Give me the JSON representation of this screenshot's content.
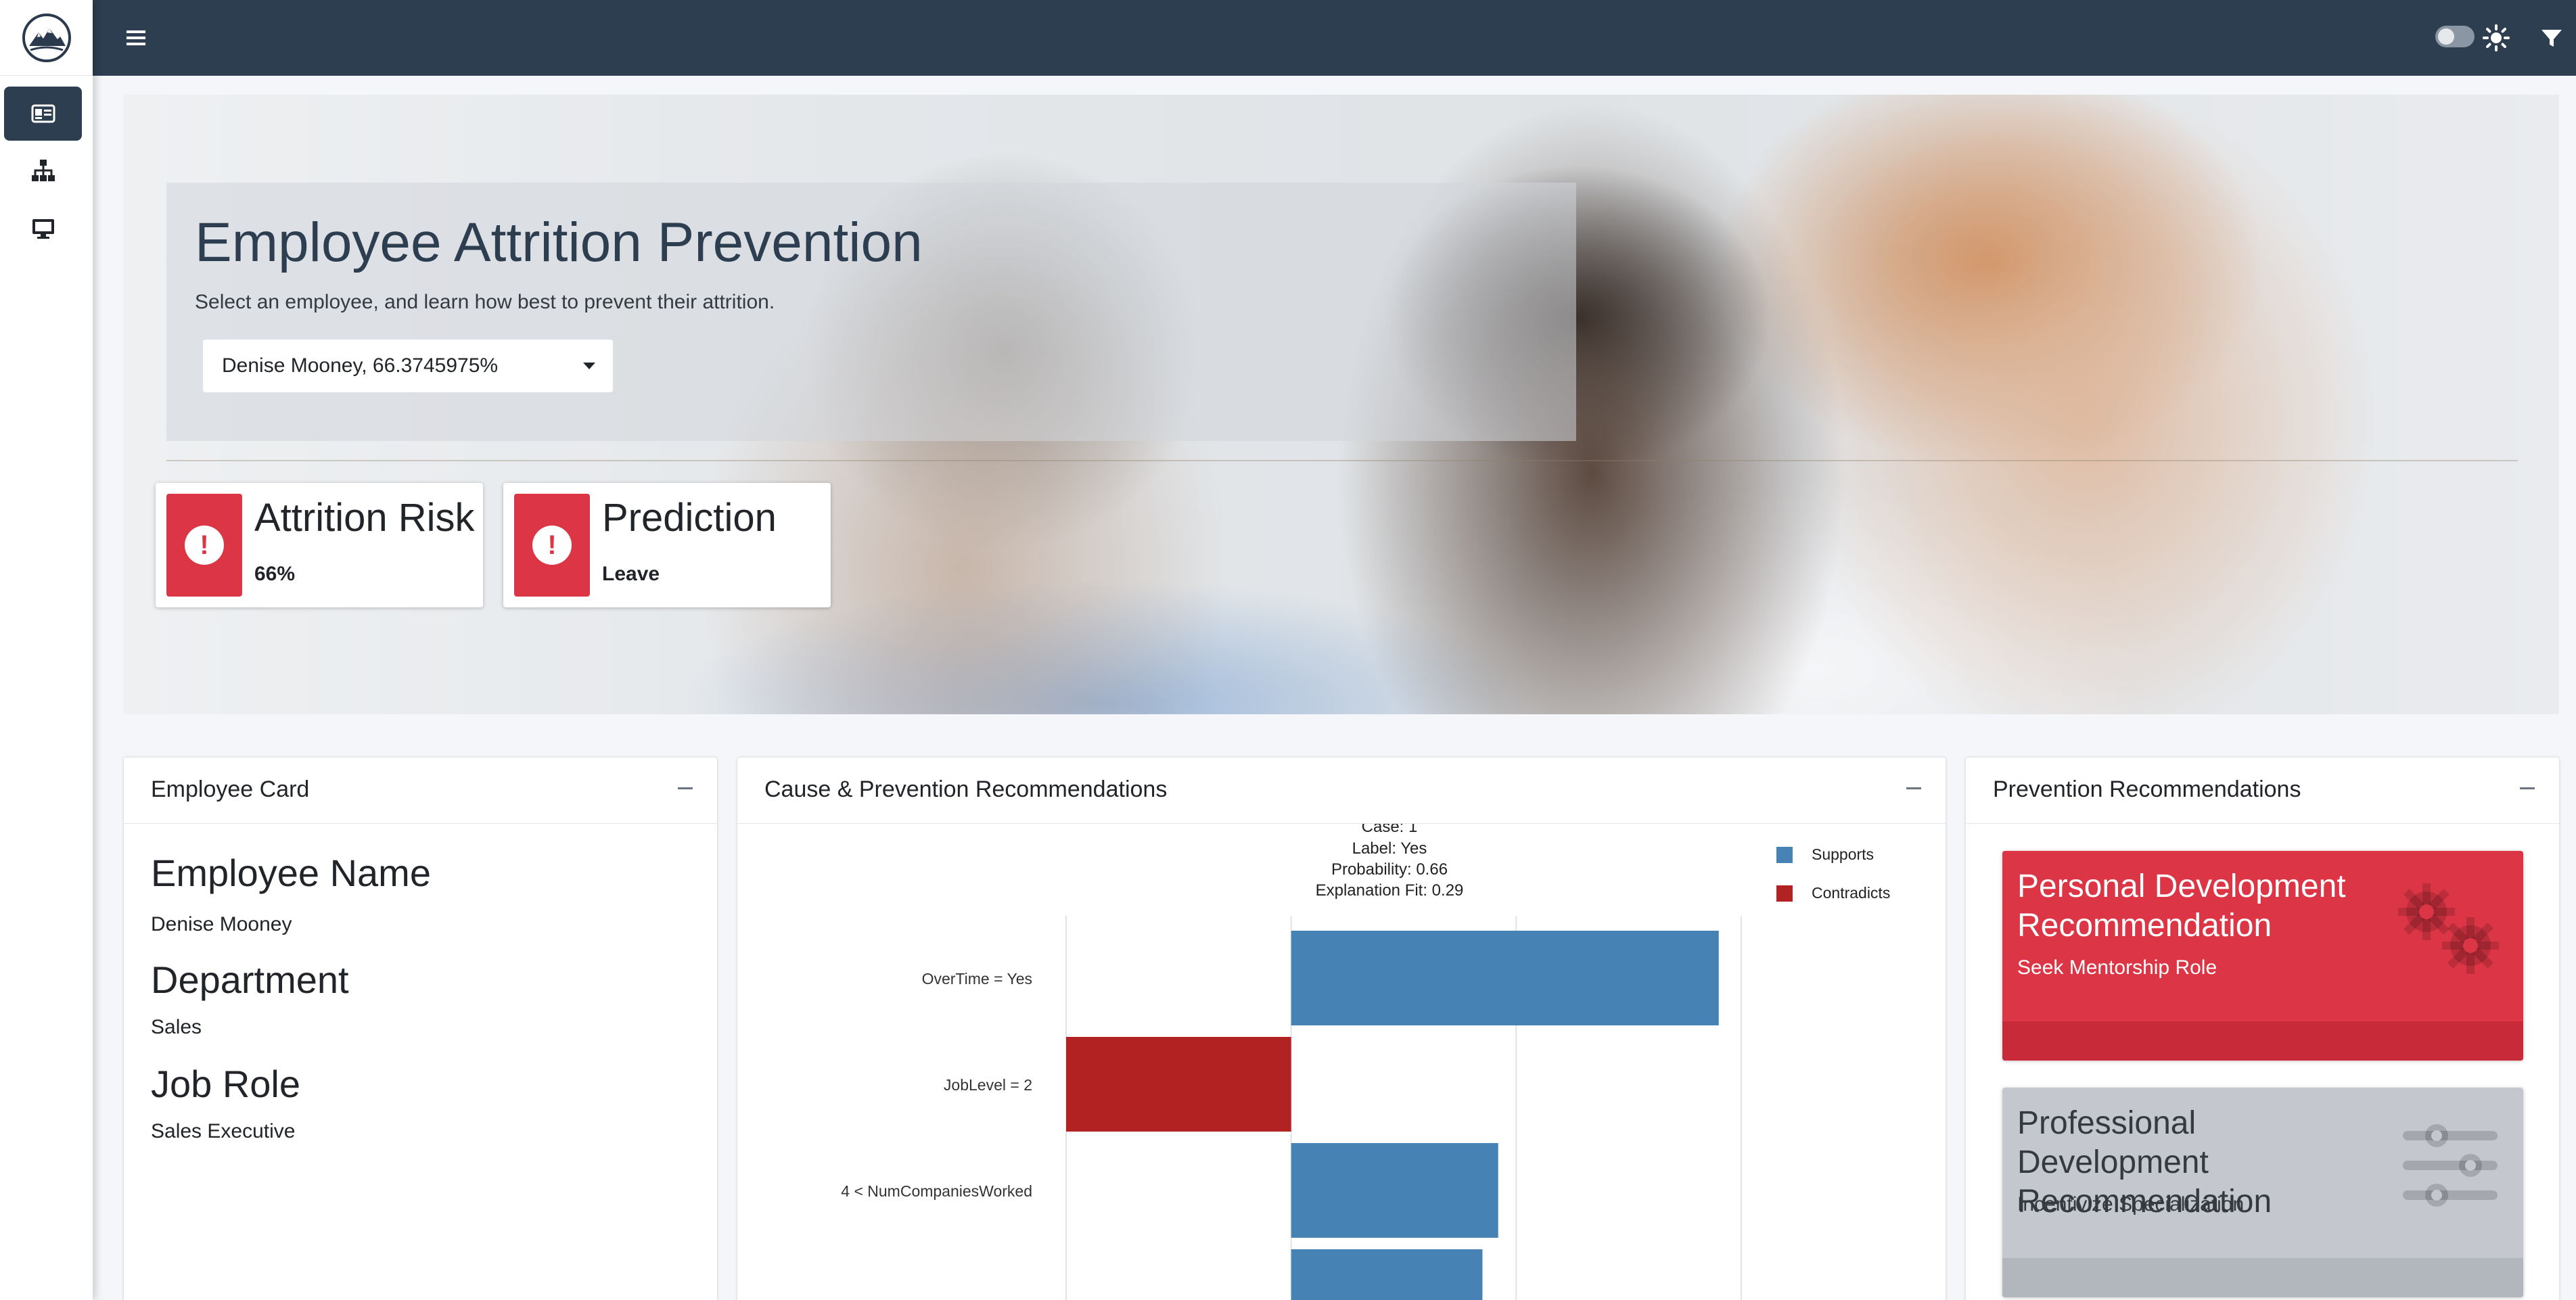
{
  "sidebar": {
    "brand": {
      "icon": "mountain-logo-icon"
    },
    "items": [
      {
        "icon": "id-card-icon",
        "active": true
      },
      {
        "icon": "sitemap-icon",
        "active": false
      },
      {
        "icon": "desktop-icon",
        "active": false
      }
    ]
  },
  "topbar": {
    "icons": [
      "hamburger-icon",
      "theme-toggle",
      "sun-icon",
      "filter-icon"
    ]
  },
  "hero": {
    "title": "Employee Attrition Prevention",
    "subtitle": "Select an employee, and learn how best to prevent their attrition.",
    "select_value": "Denise Mooney, 66.3745975%"
  },
  "info_boxes": [
    {
      "label": "Attrition Risk",
      "value": "66%",
      "icon": "exclamation-circle-icon",
      "color": "#dc3545"
    },
    {
      "label": "Prediction",
      "value": "Leave",
      "icon": "exclamation-circle-icon",
      "color": "#dc3545"
    }
  ],
  "employee_card": {
    "title": "Employee Card",
    "fields": [
      {
        "label": "Employee Name",
        "value": "Denise Mooney"
      },
      {
        "label": "Department",
        "value": "Sales"
      },
      {
        "label": "Job Role",
        "value": "Sales Executive"
      }
    ]
  },
  "cause_card": {
    "title": "Cause & Prevention Recommendations"
  },
  "chart_data": {
    "type": "bar",
    "orientation": "horizontal",
    "header_lines": [
      "Case: 1",
      "Label: Yes",
      "Probability: 0.66",
      "Explanation Fit: 0.29"
    ],
    "categories": [
      "OverTime = Yes",
      "JobLevel = 2",
      "4 < NumCompaniesWorked",
      ""
    ],
    "values": [
      0.19,
      -0.1,
      0.092,
      0.085
    ],
    "legend": [
      {
        "name": "Supports",
        "color": "#4682b4"
      },
      {
        "name": "Contradicts",
        "color": "#b22222"
      }
    ],
    "xlim": [
      -0.1,
      0.2
    ],
    "grid": true,
    "legend_position": "right"
  },
  "prevention_card": {
    "title": "Prevention Recommendations",
    "recommendations": [
      {
        "title": "Personal Development Recommendation",
        "value": "Seek Mentorship Role",
        "icon": "gears-icon",
        "color": "#dc3545"
      },
      {
        "title": "Professional Development Recommendation",
        "value": "Incentivize Specialization",
        "icon": "sliders-icon",
        "color": "#c4c8ce"
      }
    ]
  }
}
